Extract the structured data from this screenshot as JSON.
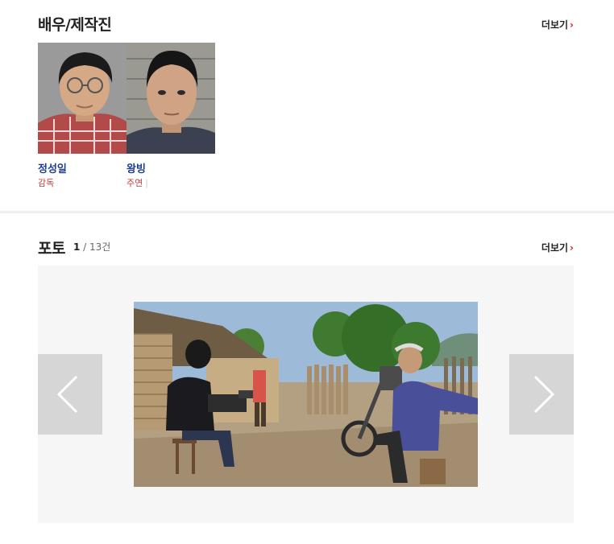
{
  "cast_section": {
    "title": "배우/제작진",
    "more_label": "더보기",
    "members": [
      {
        "name": "정성일",
        "role": "감독"
      },
      {
        "name": "왕빙",
        "role": "주연"
      }
    ]
  },
  "photo_section": {
    "title": "포토",
    "current": "1",
    "total": "13건",
    "more_label": "더보기"
  },
  "colors": {
    "accent_red": "#e02020",
    "name_blue": "#1f3e8f",
    "role_red": "#c83a3a"
  }
}
